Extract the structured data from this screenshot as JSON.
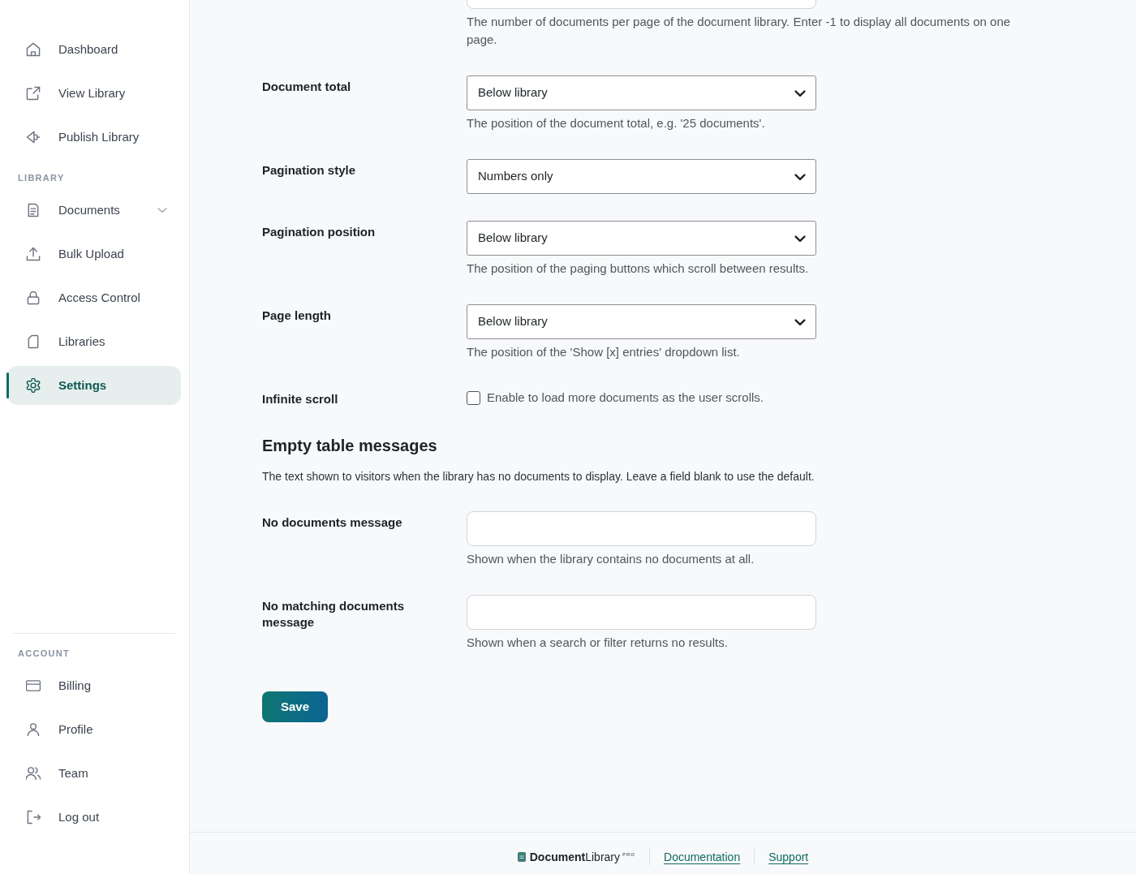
{
  "sidebar": {
    "groups": [
      {
        "items": [
          {
            "label": "Dashboard",
            "kind": "link",
            "selected": false
          },
          {
            "label": "View Library",
            "kind": "link",
            "selected": false
          },
          {
            "label": "Publish Library",
            "kind": "link",
            "selected": false
          }
        ]
      },
      {
        "heading": "LIBRARY",
        "items": [
          {
            "label": "Documents",
            "kind": "submenu",
            "expanded": false,
            "selected": false
          },
          {
            "label": "Bulk Upload",
            "kind": "link",
            "selected": false
          },
          {
            "label": "Access Control",
            "kind": "link",
            "selected": false
          },
          {
            "label": "Libraries",
            "kind": "link",
            "selected": false
          },
          {
            "label": "Settings",
            "kind": "link",
            "selected": true
          }
        ]
      },
      {
        "heading": "ACCOUNT",
        "items": [
          {
            "label": "Billing",
            "kind": "link",
            "selected": false
          },
          {
            "label": "Profile",
            "kind": "link",
            "selected": false
          },
          {
            "label": "Team",
            "kind": "link",
            "selected": false
          },
          {
            "label": "Log out",
            "kind": "link",
            "selected": false
          }
        ]
      }
    ]
  },
  "settings": {
    "rows": [
      {
        "kind": "text",
        "help": "The number of documents per page of the document library. Enter -1 to display all documents on one page."
      },
      {
        "kind": "select",
        "label": "Document total",
        "value": "Below library",
        "help": "The position of the document total, e.g. '25 documents'."
      },
      {
        "kind": "select",
        "label": "Pagination style",
        "value": "Numbers only"
      },
      {
        "kind": "select",
        "label": "Pagination position",
        "value": "Below library",
        "help": "The position of the paging buttons which scroll between results."
      },
      {
        "kind": "select",
        "label": "Page length",
        "value": "Below library",
        "help": "The position of the 'Show [x] entries' dropdown list."
      },
      {
        "kind": "checkbox",
        "label": "Infinite scroll",
        "text": "Enable to load more documents as the user scrolls.",
        "checked": false
      }
    ]
  },
  "empty_messages": {
    "heading": "Empty table messages",
    "description": "The text shown to visitors when the library has no documents to display. Leave a field blank to use the default.",
    "rows": [
      {
        "kind": "text",
        "label": "No documents message",
        "help": "Shown when the library contains no documents at all."
      },
      {
        "kind": "text",
        "label": "No matching documents message",
        "help": "Shown when a search or filter returns no results."
      }
    ]
  },
  "save_button": "Save",
  "footer": {
    "logo": "**Document**Library$^{PRO}$",
    "links": [
      "Documentation",
      "Support"
    ]
  }
}
